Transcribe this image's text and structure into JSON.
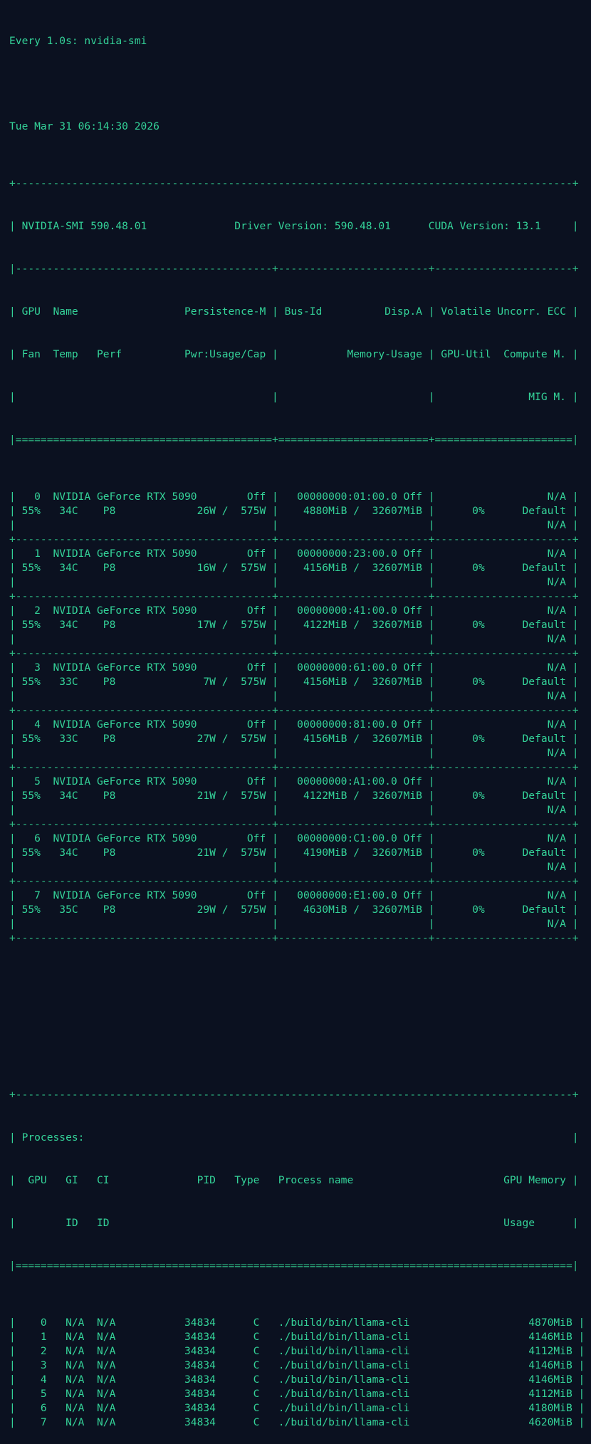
{
  "terminal": {
    "watch_header": "Every 1.0s: nvidia-smi",
    "timestamp": "Tue Mar 31 06:14:30 2026",
    "border_dash": "+-----------------------------------------------------------------------------------------+",
    "version_line": "| NVIDIA-SMI 590.48.01              Driver Version: 590.48.01      CUDA Version: 13.1     |",
    "section_sep": "|-----------------------------------------+------------------------+----------------------+",
    "col_header_1": "| GPU  Name                 Persistence-M | Bus-Id          Disp.A | Volatile Uncorr. ECC |",
    "col_header_2": "| Fan  Temp   Perf          Pwr:Usage/Cap |           Memory-Usage | GPU-Util  Compute M. |",
    "col_header_3": "|                                         |                        |               MIG M. |",
    "double_sep": "|=========================================+========================+======================|",
    "gpu_sep": "+-----------------------------------------+------------------------+----------------------+",
    "gpus": [
      {
        "l1": "|   0  NVIDIA GeForce RTX 5090        Off |   00000000:01:00.0 Off |                  N/A |",
        "l2": "| 55%   34C    P8             26W /  575W |    4880MiB /  32607MiB |      0%      Default |",
        "l3": "|                                         |                        |                  N/A |"
      },
      {
        "l1": "|   1  NVIDIA GeForce RTX 5090        Off |   00000000:23:00.0 Off |                  N/A |",
        "l2": "| 55%   34C    P8             16W /  575W |    4156MiB /  32607MiB |      0%      Default |",
        "l3": "|                                         |                        |                  N/A |"
      },
      {
        "l1": "|   2  NVIDIA GeForce RTX 5090        Off |   00000000:41:00.0 Off |                  N/A |",
        "l2": "| 55%   34C    P8             17W /  575W |    4122MiB /  32607MiB |      0%      Default |",
        "l3": "|                                         |                        |                  N/A |"
      },
      {
        "l1": "|   3  NVIDIA GeForce RTX 5090        Off |   00000000:61:00.0 Off |                  N/A |",
        "l2": "| 55%   33C    P8              7W /  575W |    4156MiB /  32607MiB |      0%      Default |",
        "l3": "|                                         |                        |                  N/A |"
      },
      {
        "l1": "|   4  NVIDIA GeForce RTX 5090        Off |   00000000:81:00.0 Off |                  N/A |",
        "l2": "| 55%   33C    P8             27W /  575W |    4156MiB /  32607MiB |      0%      Default |",
        "l3": "|                                         |                        |                  N/A |"
      },
      {
        "l1": "|   5  NVIDIA GeForce RTX 5090        Off |   00000000:A1:00.0 Off |                  N/A |",
        "l2": "| 55%   34C    P8             21W /  575W |    4122MiB /  32607MiB |      0%      Default |",
        "l3": "|                                         |                        |                  N/A |"
      },
      {
        "l1": "|   6  NVIDIA GeForce RTX 5090        Off |   00000000:C1:00.0 Off |                  N/A |",
        "l2": "| 55%   34C    P8             21W /  575W |    4190MiB /  32607MiB |      0%      Default |",
        "l3": "|                                         |                        |                  N/A |"
      },
      {
        "l1": "|   7  NVIDIA GeForce RTX 5090        Off |   00000000:E1:00.0 Off |                  N/A |",
        "l2": "| 55%   35C    P8             29W /  575W |    4630MiB /  32607MiB |      0%      Default |",
        "l3": "|                                         |                        |                  N/A |"
      }
    ],
    "gpu_bottom": "+-----------------------------------------+------------------------+----------------------+",
    "proc_top": "+-----------------------------------------------------------------------------------------+",
    "proc_title": "| Processes:                                                                              |",
    "proc_header_1": "|  GPU   GI   CI              PID   Type   Process name                        GPU Memory |",
    "proc_header_2": "|        ID   ID                                                               Usage      |",
    "proc_double": "|=========================================================================================|",
    "processes": [
      "|    0   N/A  N/A           34834      C   ./build/bin/llama-cli                   4870MiB |",
      "|    1   N/A  N/A           34834      C   ./build/bin/llama-cli                   4146MiB |",
      "|    2   N/A  N/A           34834      C   ./build/bin/llama-cli                   4112MiB |",
      "|    3   N/A  N/A           34834      C   ./build/bin/llama-cli                   4146MiB |",
      "|    4   N/A  N/A           34834      C   ./build/bin/llama-cli                   4146MiB |",
      "|    5   N/A  N/A           34834      C   ./build/bin/llama-cli                   4112MiB |",
      "|    6   N/A  N/A           34834      C   ./build/bin/llama-cli                   4180MiB |",
      "|    7   N/A  N/A           34834      C   ./build/bin/llama-cli                   4620MiB |"
    ]
  }
}
